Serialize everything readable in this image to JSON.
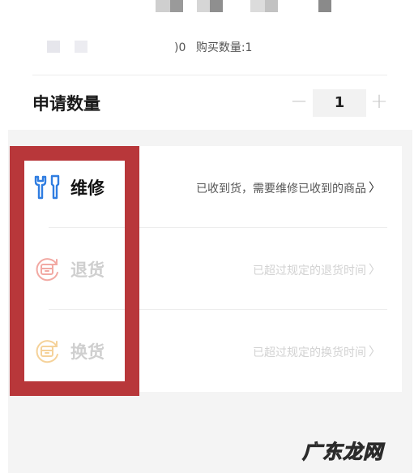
{
  "product": {
    "price_fragment": ")0",
    "purchase_qty_label": "购买数量:1"
  },
  "apply": {
    "label": "申请数量",
    "minus": "−",
    "quantity": "1",
    "plus": "+"
  },
  "services": [
    {
      "title": "维修",
      "desc": "已收到货，需要维修已收到的商品",
      "chevron": "〉",
      "enabled": true,
      "icon": "wrench-screwdriver-icon"
    },
    {
      "title": "退货",
      "desc": "已超过规定的退货时间",
      "chevron": "〉",
      "enabled": false,
      "icon": "return-refresh-icon"
    },
    {
      "title": "换货",
      "desc": "已超过规定的换货时间",
      "chevron": "〉",
      "enabled": false,
      "icon": "exchange-refresh-icon"
    }
  ],
  "colors": {
    "repair_icon": "#2f7de1",
    "return_icon": "#f2a9a3",
    "exchange_icon": "#f5d29a",
    "annotation_red": "#b8373a"
  },
  "watermark": "广东龙网"
}
